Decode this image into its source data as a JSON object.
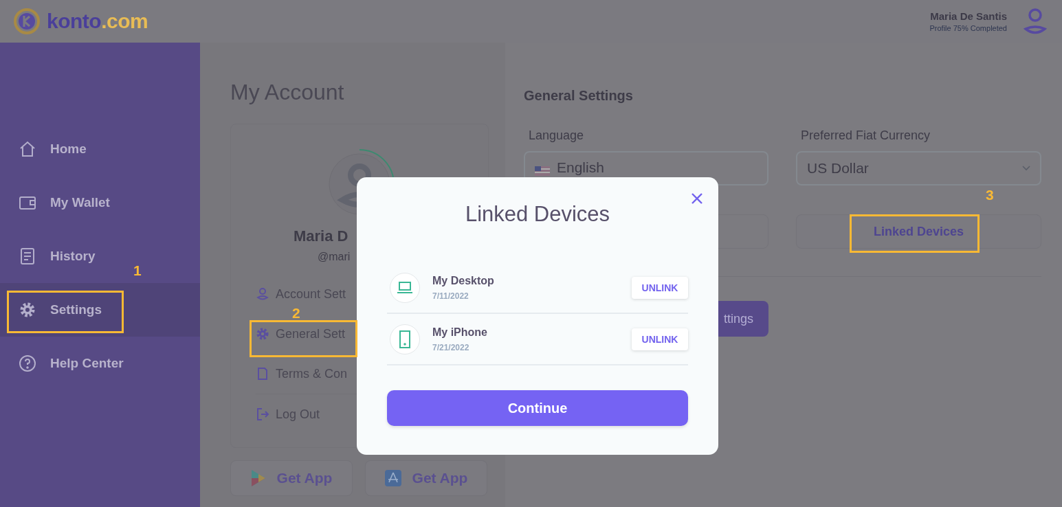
{
  "header": {
    "logo_name": "konto",
    "logo_domain": ".com",
    "user_name": "Maria De Santis",
    "user_subtitle": "Profile 75% Completed"
  },
  "sidebar": {
    "items": [
      {
        "label": "Home",
        "kind": "home",
        "selected": false
      },
      {
        "label": "My Wallet",
        "kind": "wallet",
        "selected": false
      },
      {
        "label": "History",
        "kind": "history",
        "selected": false
      },
      {
        "label": "Settings",
        "kind": "gear",
        "selected": true
      },
      {
        "label": "Help Center",
        "kind": "help",
        "selected": false
      }
    ]
  },
  "account": {
    "title": "My Account",
    "name": "Maria D",
    "handle": "@mari",
    "menu": [
      {
        "label": "Account Sett",
        "kind": "user"
      },
      {
        "label": "General Sett",
        "kind": "gear"
      },
      {
        "label": "Terms & Con",
        "kind": "doc"
      },
      {
        "label": "Log Out",
        "kind": "logout"
      }
    ],
    "apps": [
      {
        "label": "Get App",
        "kind": "play"
      },
      {
        "label": "Get App",
        "kind": "appstore"
      }
    ]
  },
  "settings": {
    "title": "General Settings",
    "fields": [
      {
        "label": "Language",
        "value": "English",
        "kind": "flag"
      },
      {
        "label": "Preferred Fiat Currency",
        "value": "US Dollar",
        "kind": "select"
      }
    ],
    "linked_button": "Linked Devices",
    "save_button": "ttings"
  },
  "modal": {
    "title": "Linked Devices",
    "devices": [
      {
        "name": "My Desktop",
        "date": "7/11/2022",
        "kind": "laptop",
        "action": "UNLINK"
      },
      {
        "name": "My iPhone",
        "date": "7/21/2022",
        "kind": "phone",
        "action": "UNLINK"
      }
    ],
    "primary": "Continue"
  },
  "annotations": [
    {
      "label": "1"
    },
    {
      "label": "2"
    },
    {
      "label": "3"
    }
  ]
}
